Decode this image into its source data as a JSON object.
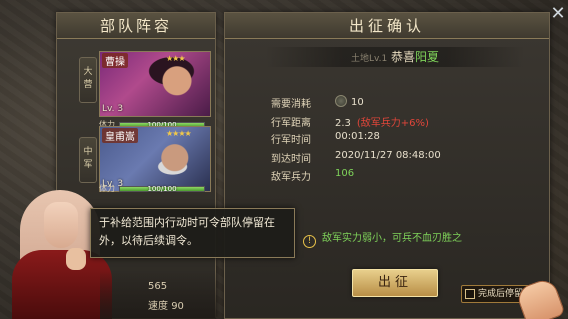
{
  "left_panel": {
    "title": "部队阵容",
    "slots": [
      {
        "tag": "大营",
        "name": "曹操",
        "stars": "★★★",
        "level": "Lv. 3",
        "hp_label": "体力",
        "hp_text": "100/100",
        "hp_fraction": 1.0
      },
      {
        "tag": "中军",
        "name": "皇甫嵩",
        "stars": "★★★★",
        "level": "Lv. 3",
        "hp_label": "体力",
        "hp_text": "100/100",
        "hp_fraction": 1.0
      }
    ],
    "troops": "565",
    "speed_label": "速度",
    "speed_value": "90"
  },
  "right_panel": {
    "title": "出征确认",
    "land_label": "土地Lv.1",
    "target_name": "恭喜",
    "target_city": "阳夏",
    "rows": {
      "cost_label": "需要消耗",
      "cost_value": "10",
      "distance_label": "行军距离",
      "distance_value": "2.3",
      "distance_note": "(敌军兵力+6%)",
      "time_label": "行军时间",
      "time_value": "00:01:28",
      "arrive_label": "到达时间",
      "arrive_value": "2020/11/27 08:48:00",
      "enemy_label": "敌军兵力",
      "enemy_value": "106"
    },
    "warning": "敌军实力弱小，可兵不血刃胜之",
    "march_button": "出征",
    "stay_checkbox": "完成后停留"
  },
  "tooltip": {
    "text": "于补给范围内行动时可令部队停留在外，以待后续调令。"
  },
  "close_glyph": "✕",
  "colors": {
    "accent_gold": "#e8cf8c",
    "warn_red": "#e2463a",
    "good_green": "#7fd35a"
  }
}
